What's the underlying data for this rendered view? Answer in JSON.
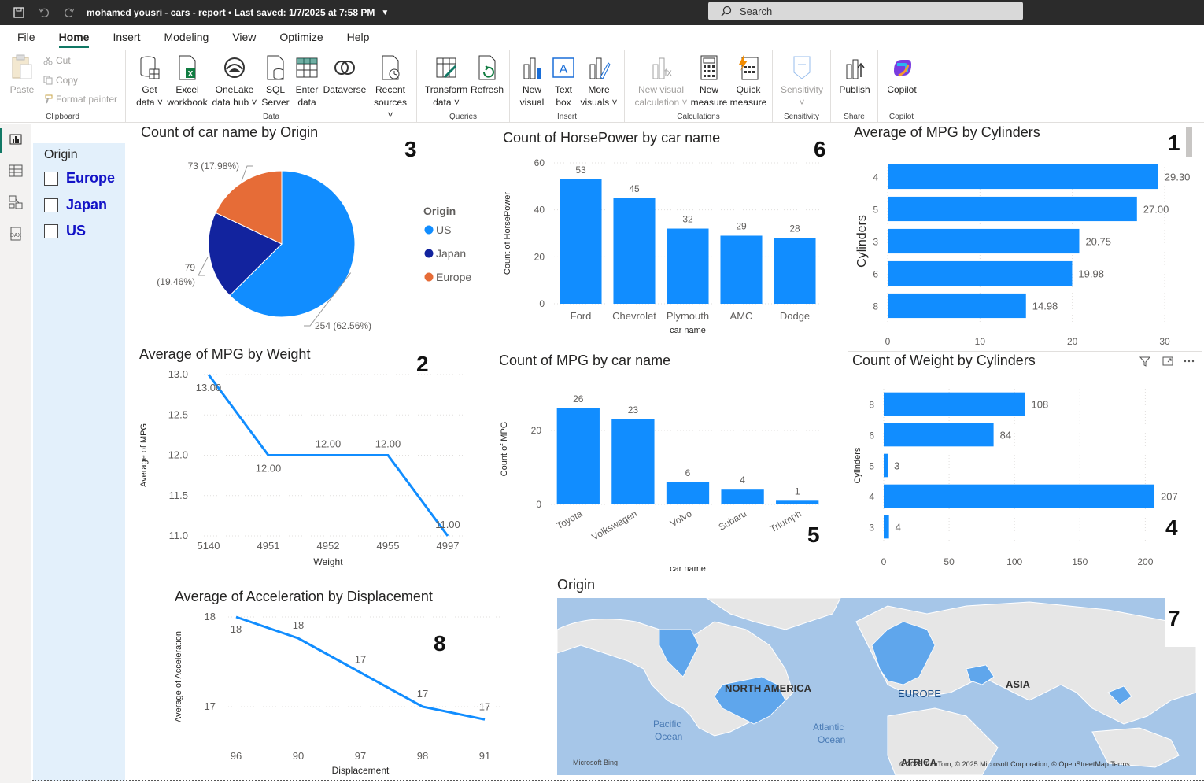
{
  "titlebar": {
    "title": "mohamed yousri - cars - report • Last saved: 1/7/2025 at 7:58 PM",
    "search_placeholder": "Search"
  },
  "menu": [
    "File",
    "Home",
    "Insert",
    "Modeling",
    "View",
    "Optimize",
    "Help"
  ],
  "ribbon": {
    "clipboard": {
      "label": "Clipboard",
      "paste": "Paste",
      "cut": "Cut",
      "copy": "Copy",
      "format_painter": "Format painter"
    },
    "data": {
      "label": "Data",
      "get_data": [
        "Get",
        "data ˅"
      ],
      "excel": [
        "Excel",
        "workbook"
      ],
      "onelake": [
        "OneLake",
        "data hub ˅"
      ],
      "sql": [
        "SQL",
        "Server"
      ],
      "enter": [
        "Enter",
        "data"
      ],
      "dataverse": [
        "Dataverse"
      ],
      "recent": [
        "Recent",
        "sources ˅"
      ]
    },
    "queries": {
      "label": "Queries",
      "transform": [
        "Transform",
        "data ˅"
      ],
      "refresh": [
        "Refresh"
      ]
    },
    "insert": {
      "label": "Insert",
      "new_visual": [
        "New",
        "visual"
      ],
      "text_box": [
        "Text",
        "box"
      ],
      "more_visuals": [
        "More",
        "visuals ˅"
      ]
    },
    "calculations": {
      "label": "Calculations",
      "new_visual_calc": [
        "New visual",
        "calculation ˅"
      ],
      "new_measure": [
        "New",
        "measure"
      ],
      "quick_measure": [
        "Quick",
        "measure"
      ]
    },
    "sensitivity": {
      "label": "Sensitivity",
      "btn": [
        "Sensitivity",
        "˅"
      ]
    },
    "share": {
      "label": "Share",
      "publish": [
        "Publish"
      ]
    },
    "copilot": {
      "label": "Copilot",
      "btn": [
        "Copilot"
      ]
    }
  },
  "slicer": {
    "title": "Origin",
    "items": [
      "Europe",
      "Japan",
      "US"
    ]
  },
  "visual_numbers": [
    "3",
    "6",
    "1",
    "2",
    "5",
    "4",
    "8",
    "7"
  ],
  "map": {
    "title": "Origin",
    "labels": [
      "NORTH AMERICA",
      "EUROPE",
      "ASIA",
      "Pacific",
      "Ocean",
      "Atlantic",
      "Ocean",
      "AFRICA"
    ],
    "attribution": "© 2025 TomTom, © 2025 Microsoft Corporation, © OpenStreetMap  Terms",
    "logo": "Microsoft Bing"
  },
  "colors": {
    "bar": "#118dff",
    "us": "#118dff",
    "japan": "#12239e",
    "europe": "#e66c37",
    "accent": "#117865"
  },
  "chart_data": [
    {
      "id": "pie",
      "type": "pie",
      "title": "Count of car name by Origin",
      "legend_title": "Origin",
      "legend": "right",
      "slices": [
        {
          "name": "US",
          "value": 254,
          "label": "254 (62.56%)"
        },
        {
          "name": "Japan",
          "value": 79,
          "label": "79 (19.46%)"
        },
        {
          "name": "Europe",
          "value": 73,
          "label": "73 (17.98%)"
        }
      ]
    },
    {
      "id": "hp",
      "type": "bar",
      "title": "Count of HorsePower by car name",
      "xlabel": "car name",
      "ylabel": "Count of HorsePower",
      "categories": [
        "Ford",
        "Chevrolet",
        "Plymouth",
        "AMC",
        "Dodge"
      ],
      "values": [
        53,
        45,
        32,
        29,
        28
      ],
      "ylim": [
        0,
        60
      ],
      "yticks": [
        0,
        20,
        40,
        60
      ]
    },
    {
      "id": "mpgcyl",
      "type": "bar",
      "orientation": "horizontal",
      "title": "Average of MPG by Cylinders",
      "ylabel": "Cylinders",
      "categories": [
        "4",
        "5",
        "3",
        "6",
        "8"
      ],
      "values": [
        29.3,
        27.0,
        20.75,
        19.98,
        14.98
      ],
      "value_labels": [
        "29.30",
        "27.00",
        "20.75",
        "19.98",
        "14.98"
      ],
      "xlim": [
        0,
        30
      ],
      "xticks": [
        0,
        10,
        20,
        30
      ]
    },
    {
      "id": "mpgw",
      "type": "line",
      "title": "Average of MPG by Weight",
      "xlabel": "Weight",
      "ylabel": "Average of MPG",
      "x": [
        "5140",
        "4951",
        "4952",
        "4955",
        "4997"
      ],
      "values": [
        13.0,
        12.0,
        12.0,
        12.0,
        11.0
      ],
      "value_labels": [
        "13.00",
        "12.00",
        "12.00",
        "12.00",
        "11.00"
      ],
      "ylim": [
        11.0,
        13.0
      ],
      "yticks": [
        "11.0",
        "11.5",
        "12.0",
        "12.5",
        "13.0"
      ]
    },
    {
      "id": "mpgcar",
      "type": "bar",
      "title": "Count of MPG by car name",
      "xlabel": "car name",
      "ylabel": "Count of MPG",
      "categories": [
        "Toyota",
        "Volkswagen",
        "Volvo",
        "Subaru",
        "Triumph"
      ],
      "values": [
        26,
        23,
        6,
        4,
        1
      ],
      "ylim": [
        0,
        30
      ],
      "yticks": [
        0,
        20
      ]
    },
    {
      "id": "wcyl",
      "type": "bar",
      "orientation": "horizontal",
      "title": "Count of Weight by Cylinders",
      "ylabel": "Cylinders",
      "categories": [
        "8",
        "6",
        "5",
        "4",
        "3"
      ],
      "values": [
        108,
        84,
        3,
        207,
        4
      ],
      "xlim": [
        0,
        210
      ],
      "xticks": [
        0,
        50,
        100,
        150,
        200
      ]
    },
    {
      "id": "acc",
      "type": "line",
      "title": "Average of Acceleration by Displacement",
      "xlabel": "Displacement",
      "ylabel": "Average of Acceleration",
      "x": [
        "96",
        "90",
        "97",
        "98",
        "91"
      ],
      "values": [
        18.0,
        17.75,
        17.35,
        16.95,
        16.8
      ],
      "value_labels": [
        "18",
        "18",
        "17",
        "17",
        "17"
      ],
      "ylim": [
        16.6,
        18.0
      ],
      "yticks": [
        "17",
        "18"
      ]
    }
  ]
}
